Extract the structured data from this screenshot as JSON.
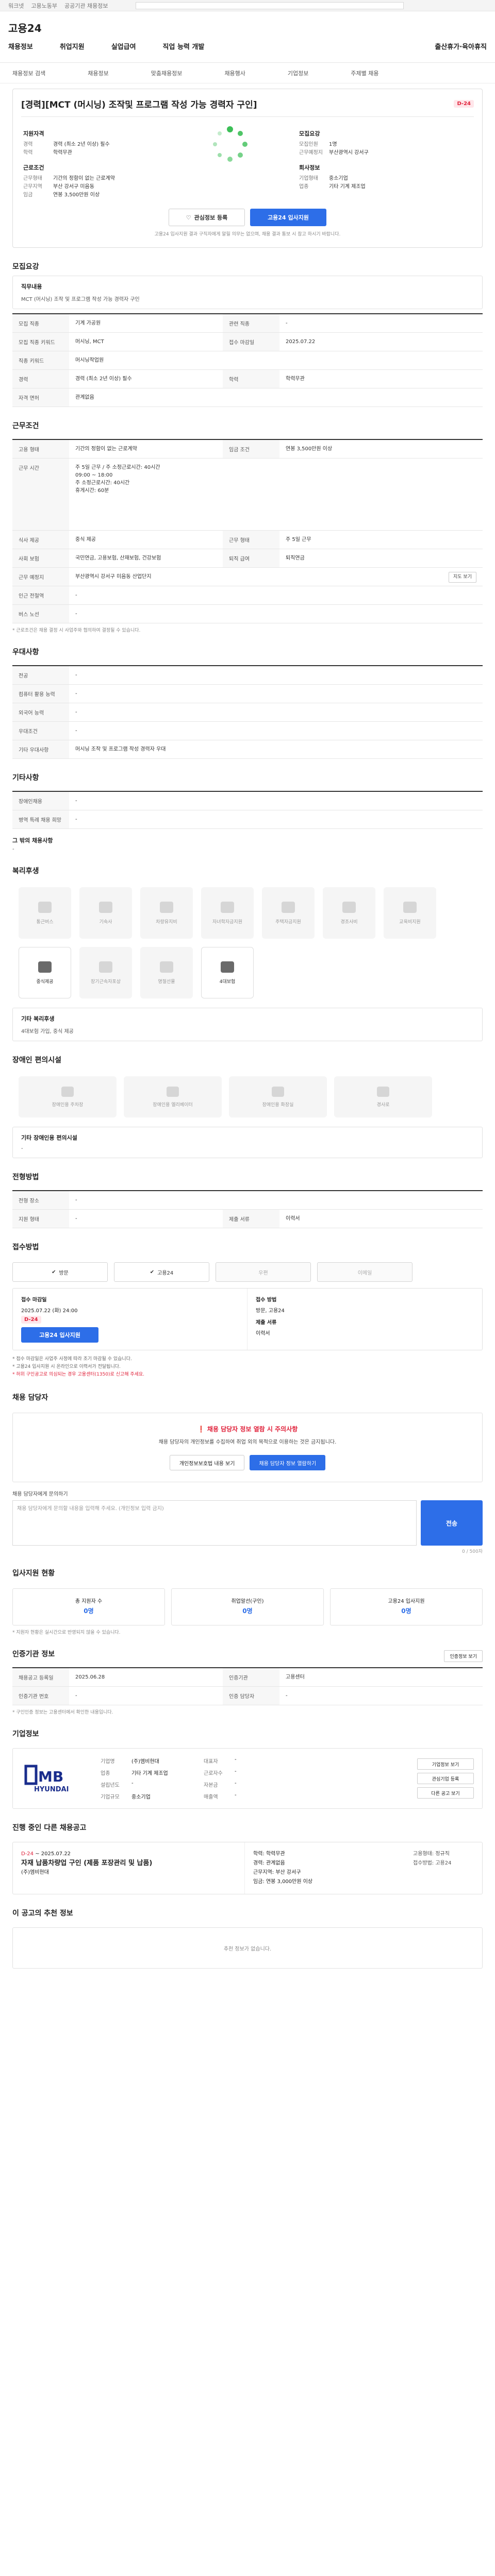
{
  "topbar": {
    "links": [
      "워크넷",
      "고용노동부",
      "공공기관 채용정보"
    ],
    "search_placeholder": "검색"
  },
  "header": {
    "logo": "고용24",
    "menu": [
      "채용정보",
      "취업지원",
      "실업급여",
      "직업 능력 개발",
      "출산휴가·육아휴직"
    ]
  },
  "subnav": [
    "채용정보 검색",
    "채용정보",
    "맞춤채용정보",
    "채용행사",
    "기업정보",
    "주제별 채용"
  ],
  "job": {
    "title": "[경력][MCT (머시닝) 조작및 프로그램 작성 가능 경력자 구인]",
    "dday": "D-24",
    "left_head": "지원자격",
    "left_kv": [
      [
        "경력",
        "경력 (최소 2년 이상) 필수"
      ],
      [
        "학력",
        "학력무관"
      ]
    ],
    "left_head2": "근로조건",
    "left_kv2": [
      [
        "근무형태",
        "기간의 정함이 없는 근로계약"
      ],
      [
        "근무지역",
        "부산 강서구 미음동"
      ],
      [
        "임금",
        "연봉 3,500만원 이상"
      ]
    ],
    "right_head": "모집요강",
    "right_kv": [
      [
        "모집인원",
        "1명"
      ],
      [
        "근무예정지",
        "부산광역시 강서구"
      ]
    ],
    "right_head2": "회사정보",
    "right_kv2": [
      [
        "기업형태",
        "중소기업"
      ],
      [
        "업종",
        "기타 기계 제조업"
      ]
    ],
    "btn_scrap": "관심정보 등록",
    "btn_apply": "고용24 입사지원",
    "notice": "고용24 입사지원 결과 구직자에게 알릴 의무는 없으며, 채용 결과 통보 시 참고 하시기 바랍니다."
  },
  "recruit": {
    "title": "모집요강",
    "box_title": "직무내용",
    "box_desc": "MCT (머시닝) 조작 및 프로그램 작성 가능 경력자 구인",
    "rows": [
      [
        "모집 직종",
        "기계 가공원",
        "관련 직종",
        "-"
      ],
      [
        "모집 직종 키워드",
        "머시닝, MCT",
        "접수 마감일",
        "2025.07.22"
      ],
      [
        "직종 키워드",
        "머시닝작업원",
        "",
        ""
      ],
      [
        "경력",
        "경력 (최소 2년 이상) 필수",
        "학력",
        "학력무관"
      ],
      [
        "자격 면허",
        "관계없음",
        "",
        ""
      ]
    ]
  },
  "conditions": {
    "title": "근무조건",
    "rows": [
      [
        "고용 형태",
        "기간의 정함이 없는 근로계약",
        "임금 조건",
        "연봉 3,500만원 이상"
      ],
      [
        "근무 시간",
        "주 5일 근무 / 주 소정근로시간: 40시간",
        "",
        ""
      ],
      [
        "식사 제공",
        "중식 제공",
        "근무 형태",
        "주 5일 근무"
      ],
      [
        "사회 보험",
        "국민연금, 고용보험, 산재보험, 건강보험",
        "퇴직 급여",
        "퇴직연금"
      ],
      [
        "근무 예정지",
        "부산광역시 강서구 미음동 산업단지",
        "",
        ""
      ],
      [
        "인근 전철역",
        "-",
        "",
        ""
      ],
      [
        "버스 노선",
        "-",
        "",
        ""
      ]
    ],
    "worktime_detail": [
      "09:00 ~ 18:00",
      "주 소정근로시간: 40시간",
      "휴게시간: 60분"
    ],
    "map_btn": "지도 보기",
    "footnote": "* 근로조건은 채용 결정 시 사업주와 협의하여 결정될 수 있습니다."
  },
  "preference": {
    "title": "우대사항",
    "rows": [
      [
        "전공",
        "-"
      ],
      [
        "컴퓨터 활용 능력",
        "-"
      ],
      [
        "외국어 능력",
        "-"
      ],
      [
        "우대조건",
        "-"
      ],
      [
        "기타 우대사항",
        "머시닝 조작 및 프로그램 작성 경력자 우대"
      ]
    ]
  },
  "other": {
    "title": "기타사항",
    "rows": [
      [
        "장애인채용",
        "-"
      ],
      [
        "병역 특례 채용 희망",
        "-"
      ]
    ],
    "sub_title": "그 밖의 채용사항",
    "sub_value": "-"
  },
  "welfare": {
    "title": "복리후생",
    "items": [
      [
        "통근버스",
        false
      ],
      [
        "기숙사",
        false
      ],
      [
        "차량유지비",
        false
      ],
      [
        "자녀학자금지원",
        false
      ],
      [
        "주택자금지원",
        false
      ],
      [
        "경조사비",
        false
      ],
      [
        "교육비지원",
        false
      ],
      [
        "중식제공",
        true
      ],
      [
        "장기근속자포상",
        false
      ],
      [
        "명절선물",
        false
      ],
      [
        "4대보험",
        true
      ]
    ],
    "box_title": "기타 복리후생",
    "box_desc": "4대보험 가입, 중식 제공"
  },
  "disability": {
    "title": "장애인 편의시설",
    "items": [
      "장애인용 주차장",
      "장애인용 엘리베이터",
      "장애인용 화장실",
      "경사로"
    ],
    "box_title": "기타 장애인용 편의시설",
    "box_desc": "-"
  },
  "selection": {
    "title": "전형방법",
    "rows": [
      [
        "전형 장소",
        "-"
      ],
      [
        "지원 형태",
        "-",
        "제출 서류",
        "이력서"
      ]
    ]
  },
  "apply": {
    "title": "접수방법",
    "methods": [
      [
        "방문",
        true
      ],
      [
        "고용24",
        true
      ],
      [
        "우편",
        false
      ],
      [
        "이메일",
        false
      ],
      [
        "팩스",
        false
      ]
    ],
    "col1_head": "접수 마감일",
    "col1_date": "2025.07.22 (화) 24:00",
    "col1_dday": "D-24",
    "col1_btn": "고용24 입사지원",
    "col2_head": "접수 방법",
    "col2_lines": [
      "방문, 고용24",
      "제출 서류",
      "이력서"
    ],
    "bullets": [
      "* 접수 마감일은 사업주 사정에 따라 조기 마감될 수 있습니다.",
      "* 고용24 입사지원 시 온라인으로 이력서가 전달됩니다.",
      "* 허위 구인공고로 의심되는 경우 고용센터(1350)로 신고해 주세요."
    ]
  },
  "contact": {
    "title": "채용 담당자",
    "alert_head": "채용 담당자 정보 열람 시 주의사항",
    "alert_text": "채용 담당자의 개인정보를 수집하여 취업 외의 목적으로 이용하는 것은 금지됩니다.",
    "btn1": "개인정보보호법 내용 보기",
    "btn2": "채용 담당자 정보 열람하기",
    "qa_label": "채용 담당자에게 문의하기",
    "qa_placeholder": "채용 담당자에게 문의할 내용을 입력해 주세요. (개인정보 입력 금지)",
    "qa_send": "전송",
    "qa_count": "0 / 500자"
  },
  "status": {
    "title": "입사지원 현황",
    "items": [
      [
        "총 지원자 수",
        "0명"
      ],
      [
        "취업알선(구인)",
        "0명"
      ],
      [
        "고용24 입사지원",
        "0명"
      ]
    ],
    "note": "* 지원자 현황은 실시간으로 반영되지 않을 수 있습니다."
  },
  "verify": {
    "title": "인증기관 정보",
    "btn": "인증정보 보기",
    "rows": [
      [
        "채용공고 등록일",
        "2025.06.28",
        "인증기관",
        "고용센터"
      ],
      [
        "인증기관 번호",
        "-",
        "인증 담당자",
        "-"
      ]
    ],
    "footnote": "* 구인인증 정보는 고용센터에서 확인한 내용입니다."
  },
  "company": {
    "title": "기업정보",
    "logo_text": "HYUNDAI",
    "logo_mark": "MB",
    "kv": [
      [
        "기업명",
        "(주)엠비현대"
      ],
      [
        "대표자",
        "-"
      ],
      [
        "업종",
        "기타 기계 제조업"
      ],
      [
        "근로자수",
        "-"
      ],
      [
        "설립년도",
        "-"
      ],
      [
        "자본금",
        "-"
      ],
      [
        "기업규모",
        "중소기업"
      ],
      [
        "매출액",
        "-"
      ]
    ],
    "side_btns": [
      "기업정보 보기",
      "관심기업 등록",
      "다른 공고 보기"
    ]
  },
  "next": {
    "title": "진행 중인 다른 채용공고",
    "dday": "D-24",
    "period": "~ 2025.07.22",
    "job_title": "자재 납품차량업 구인 (제품 포장관리 및 납품)",
    "company": "(주)엠비현대",
    "meta": [
      "학력: 학력무관",
      "경력: 관계없음",
      "근무지역: 부산 강서구",
      "임금: 연봉 3,000만원 이상"
    ],
    "right": [
      "고용형태: 정규직",
      "접수방법: 고용24"
    ]
  },
  "recommend": {
    "title": "이 공고의 추천 정보",
    "empty": "추천 정보가 없습니다."
  }
}
